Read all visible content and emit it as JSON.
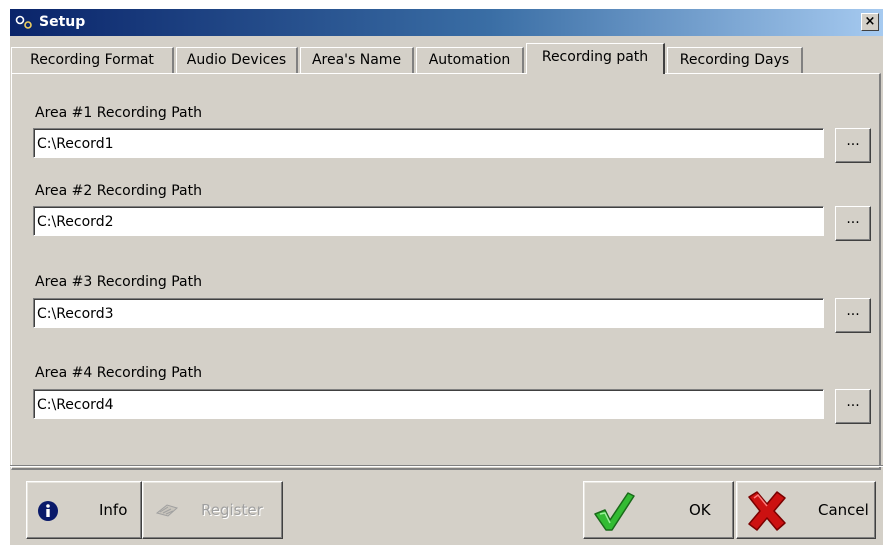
{
  "window": {
    "title": "Setup",
    "close_label": "×"
  },
  "tabs": [
    {
      "label": "Recording Format",
      "active": false
    },
    {
      "label": "Audio Devices",
      "active": false
    },
    {
      "label": "Area's Name",
      "active": false
    },
    {
      "label": "Automation",
      "active": false
    },
    {
      "label": "Recording path",
      "active": true
    },
    {
      "label": "Recording Days",
      "active": false
    }
  ],
  "paths": [
    {
      "label": "Area #1 Recording Path",
      "value": "C:\\Record1",
      "browse_label": "..."
    },
    {
      "label": "Area #2 Recording Path",
      "value": "C:\\Record2",
      "browse_label": "..."
    },
    {
      "label": "Area #3 Recording Path",
      "value": "C:\\Record3",
      "browse_label": "..."
    },
    {
      "label": "Area #4 Recording Path",
      "value": "C:\\Record4",
      "browse_label": "..."
    }
  ],
  "buttons": {
    "info": "Info",
    "register": "Register",
    "ok": "OK",
    "cancel": "Cancel"
  },
  "colors": {
    "title_bar_start": "#0a246a",
    "title_bar_end": "#a6caf0",
    "face": "#d4d0c8",
    "ok_check": "#33bb33",
    "cancel_x": "#cc1111"
  }
}
